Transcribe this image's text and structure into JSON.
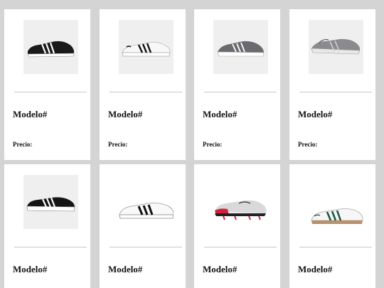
{
  "products": [
    {
      "model": "Modelo#",
      "price_label": "Precio:",
      "image": "black-white-stripe-sneaker",
      "thumb_bg": "#efefef"
    },
    {
      "model": "Modelo#",
      "price_label": "Precio:",
      "image": "white-black-stripe-sneaker",
      "thumb_bg": "#efefef"
    },
    {
      "model": "Modelo#",
      "price_label": "Precio:",
      "image": "grey-runner-sneaker",
      "thumb_bg": "#efefef"
    },
    {
      "model": "Modelo#",
      "price_label": "Precio:",
      "image": "grey-knit-sneaker",
      "thumb_bg": "#efefef"
    },
    {
      "model": "Modelo#",
      "price_label": "",
      "image": "black-skate-sneaker",
      "thumb_bg": "#efefef"
    },
    {
      "model": "Modelo#",
      "price_label": "",
      "image": "white-court-sneaker",
      "thumb_bg": "#ffffff"
    },
    {
      "model": "Modelo#",
      "price_label": "",
      "image": "football-boot",
      "thumb_bg": "#ffffff"
    },
    {
      "model": "Modelo#",
      "price_label": "",
      "image": "samba-green-sneaker",
      "thumb_bg": "#ffffff"
    }
  ],
  "colors": {
    "page_bg": "#d4d4d4",
    "card_bg": "#ffffff",
    "divider": "#c9c9c9"
  }
}
